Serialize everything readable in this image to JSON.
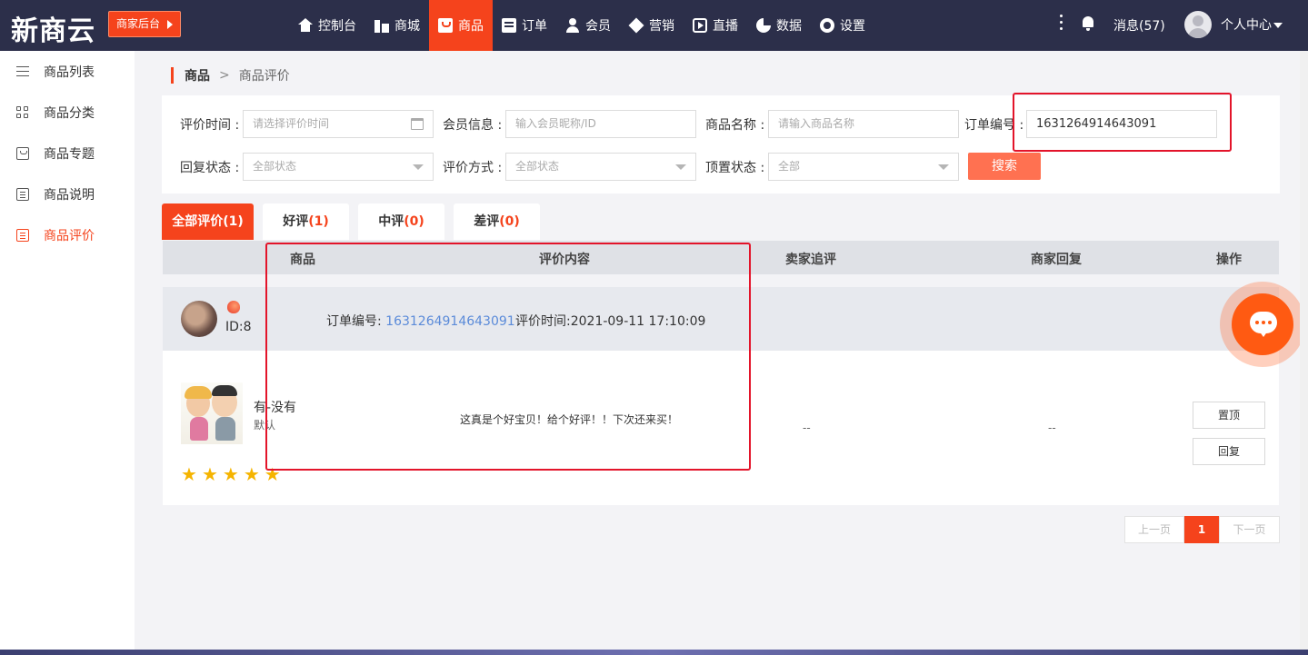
{
  "brand": {
    "logo": "新商云",
    "merchant_btn": "商家后台"
  },
  "nav": [
    {
      "label": "控制台",
      "icon": "home-icon"
    },
    {
      "label": "商城",
      "icon": "shop-icon"
    },
    {
      "label": "商品",
      "icon": "bag-icon",
      "active": true
    },
    {
      "label": "订单",
      "icon": "document-icon"
    },
    {
      "label": "会员",
      "icon": "user-icon"
    },
    {
      "label": "营销",
      "icon": "cube-icon"
    },
    {
      "label": "直播",
      "icon": "play-icon"
    },
    {
      "label": "数据",
      "icon": "pie-chart-icon"
    },
    {
      "label": "设置",
      "icon": "gear-icon"
    }
  ],
  "top_right": {
    "messages": "消息(57)",
    "user_center": "个人中心"
  },
  "sidebar": {
    "items": [
      {
        "label": "商品列表",
        "icon": "list-icon"
      },
      {
        "label": "商品分类",
        "icon": "grid-icon"
      },
      {
        "label": "商品专题",
        "icon": "bag-icon"
      },
      {
        "label": "商品说明",
        "icon": "document-icon"
      },
      {
        "label": "商品评价",
        "icon": "document-icon",
        "active": true
      }
    ]
  },
  "breadcrumb": {
    "root": "商品",
    "sep": ">",
    "current": "商品评价"
  },
  "filter": {
    "review_time_label": "评价时间 :",
    "review_time_placeholder": "请选择评价时间",
    "member_label": "会员信息 :",
    "member_placeholder": "输入会员昵称/ID",
    "product_label": "商品名称 :",
    "product_placeholder": "请输入商品名称",
    "order_label": "订单编号 :",
    "order_value": "1631264914643091",
    "reply_label": "回复状态 :",
    "reply_value": "全部状态",
    "method_label": "评价方式 :",
    "method_value": "全部状态",
    "top_label": "顶置状态 :",
    "top_value": "全部",
    "search_btn": "搜索"
  },
  "tabs": [
    {
      "label": "全部评价",
      "count": "(1)",
      "active": true
    },
    {
      "label": "好评",
      "count": "(1)"
    },
    {
      "label": "中评",
      "count": "(0)"
    },
    {
      "label": "差评",
      "count": "(0)"
    }
  ],
  "table": {
    "headers": [
      "商品",
      "评价内容",
      "卖家追评",
      "商家回复",
      "操作"
    ],
    "order": {
      "buyer_id": "ID:8",
      "order_no_label": "订单编号: ",
      "order_no": "1631264914643091",
      "review_time": "评价时间:2021-09-11 17:10:09"
    },
    "review": {
      "product_name": "有-没有",
      "product_spec": "默认",
      "stars": [
        "★",
        "★",
        "★",
        "★",
        "★"
      ],
      "content": "这真是个好宝贝！给个好评！！下次还来买！",
      "seller_follow": "--",
      "merchant_reply": "--",
      "btn_top": "置顶",
      "btn_reply": "回复"
    }
  },
  "pagination": {
    "prev": "上一页",
    "current": "1",
    "next": "下一页"
  },
  "colors": {
    "accent": "#f5431c",
    "topbar": "#2c2f4a",
    "annotation": "#e3142a",
    "link": "#5b8bd9",
    "star": "#f5b400"
  }
}
